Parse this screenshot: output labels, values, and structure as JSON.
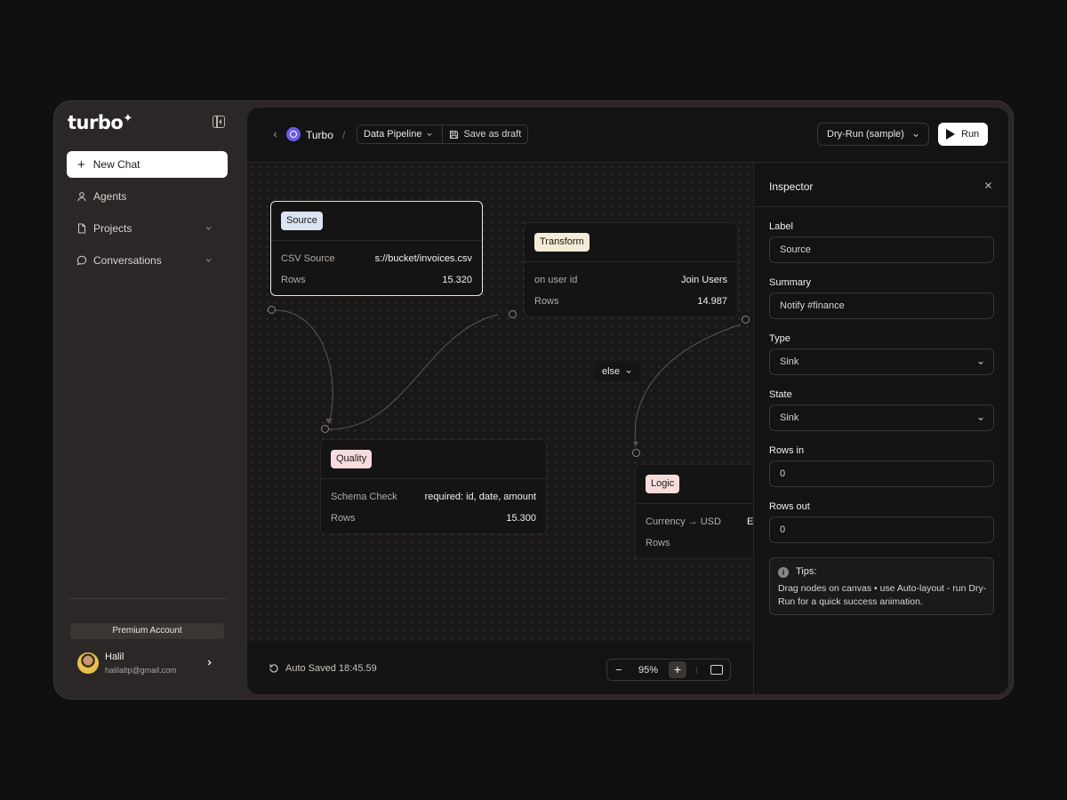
{
  "sidebar": {
    "logo": "turbo",
    "new_chat": "New Chat",
    "items": [
      {
        "label": "Agents",
        "icon": "user-icon"
      },
      {
        "label": "Projects",
        "icon": "file-icon"
      },
      {
        "label": "Conversations",
        "icon": "chat-bubble-icon"
      }
    ],
    "account_badge": "Premium Account",
    "user": {
      "name": "Halil",
      "email": "halilaltp@gmail.com"
    }
  },
  "header": {
    "brand": "Turbo",
    "separator": "/",
    "pipeline": "Data Pipeline",
    "save_draft": "Save as draft",
    "run_mode": "Dry-Run (sample)",
    "run": "Run"
  },
  "canvas": {
    "nodes": {
      "source": {
        "tag": "Source",
        "rows": [
          {
            "k": "CSV Source",
            "v": "s://bucket/invoices.csv"
          },
          {
            "k": "Rows",
            "v": "15.320"
          }
        ]
      },
      "transform": {
        "tag": "Transform",
        "rows": [
          {
            "k": "on user id",
            "v": "Join Users"
          },
          {
            "k": "Rows",
            "v": "14.987"
          }
        ]
      },
      "quality": {
        "tag": "Quality",
        "rows": [
          {
            "k": "Schema Check",
            "v": "required: id, date, amount"
          },
          {
            "k": "Rows",
            "v": "15.300"
          }
        ]
      },
      "logic": {
        "tag": "Logic",
        "rows": [
          {
            "k": "Currency → USD",
            "v": "E"
          },
          {
            "k": "Rows",
            "v": ""
          }
        ]
      }
    },
    "branch_label": "else"
  },
  "footer": {
    "autosave": "Auto Saved 18:45.59",
    "zoom_minus": "−",
    "zoom_level": "95%",
    "zoom_plus": "+"
  },
  "inspector": {
    "title": "Inspector",
    "fields": [
      {
        "label": "Label",
        "value": "Source"
      },
      {
        "label": "Summary",
        "value": "Notify #finance"
      },
      {
        "label": "Type",
        "value": "Sink"
      },
      {
        "label": "State",
        "value": "Sink"
      },
      {
        "label": "Rows in",
        "value": "0"
      },
      {
        "label": "Rows out",
        "value": "0"
      }
    ],
    "tips_title": "Tips:",
    "tips_body": "Drag nodes on canvas • use Auto-layout - run Dry-Run for a quick success animation."
  },
  "colors": {
    "background": "#111010",
    "sidebar": "#2a2726",
    "main": "#141313",
    "brand_accent": "#6d5ce6",
    "tag_source": "#dbe4f3",
    "tag_transform": "#f4ecd6",
    "tag_quality": "#f6dcdc"
  }
}
